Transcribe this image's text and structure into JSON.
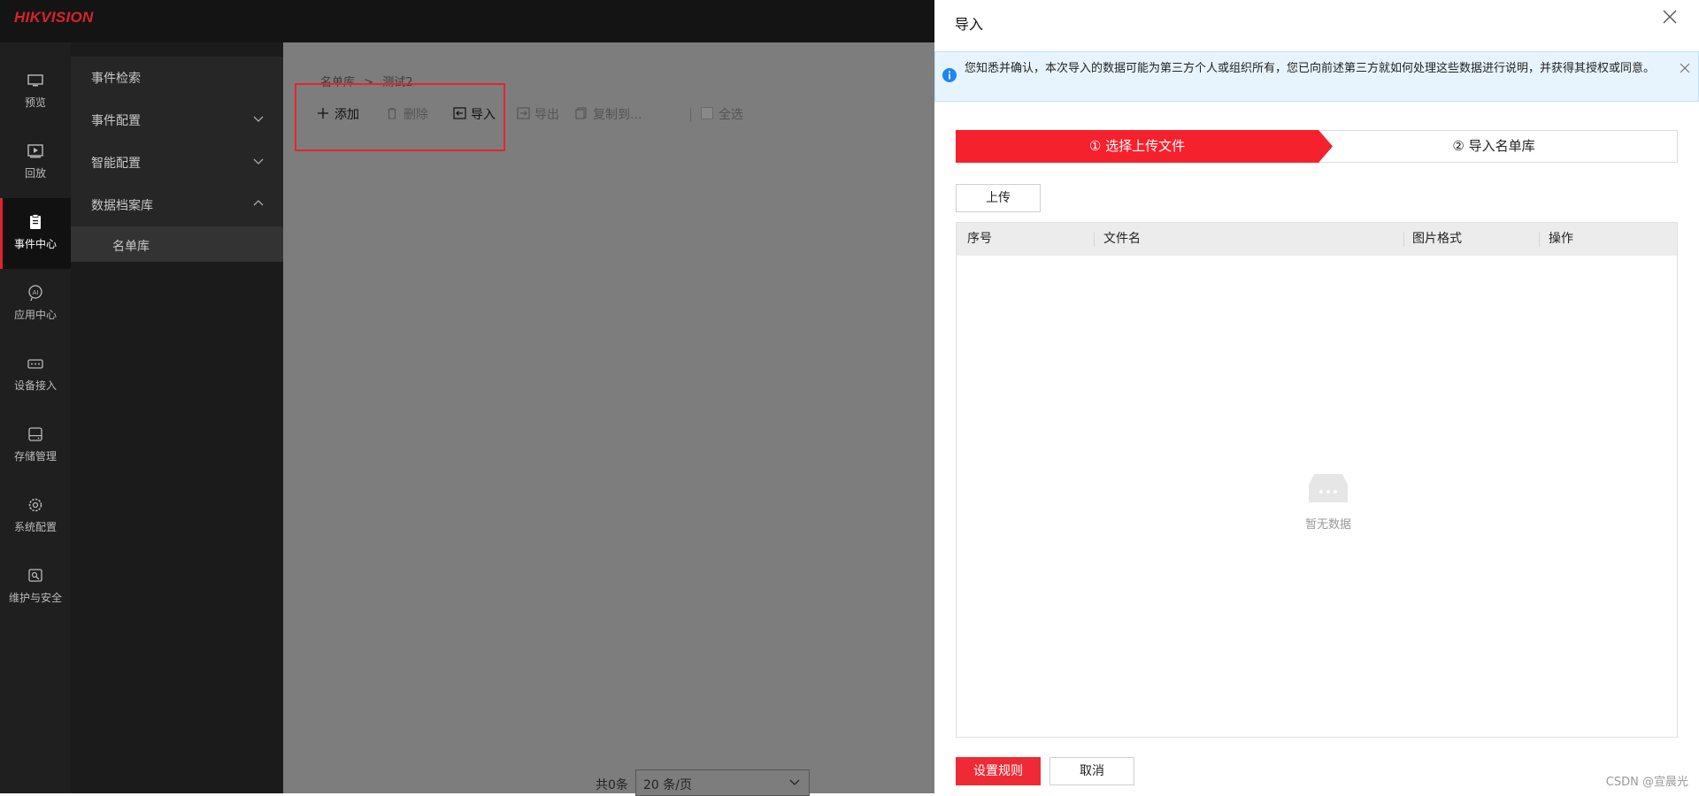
{
  "app": {
    "logo": "HIKVISION"
  },
  "nav": {
    "items": [
      {
        "label": "预览",
        "icon": "monitor-icon"
      },
      {
        "label": "回放",
        "icon": "playback-icon"
      },
      {
        "label": "事件中心",
        "icon": "clipboard-icon"
      },
      {
        "label": "应用中心",
        "icon": "ai-icon"
      },
      {
        "label": "设备接入",
        "icon": "device-icon"
      },
      {
        "label": "存储管理",
        "icon": "storage-icon"
      },
      {
        "label": "系统配置",
        "icon": "gear-icon"
      },
      {
        "label": "维护与安全",
        "icon": "maintenance-icon"
      }
    ],
    "active_index": 2
  },
  "subnav": {
    "items": [
      {
        "label": "事件检索"
      },
      {
        "label": "事件配置"
      },
      {
        "label": "智能配置"
      },
      {
        "label": "数据档案库"
      },
      {
        "label": "名单库"
      }
    ]
  },
  "content": {
    "breadcrumb": {
      "root": "名单库",
      "separator": ">",
      "current": "测试2"
    },
    "toolbar": {
      "add": "添加",
      "delete": "删除",
      "import": "导入",
      "export": "导出",
      "copy_to": "复制到...",
      "select_all": "全选"
    },
    "pager": {
      "total": "共0条",
      "page_size": "20 条/页"
    }
  },
  "dialog": {
    "title": "导入",
    "notice": "您知悉并确认，本次导入的数据可能为第三方个人或组织所有，您已向前述第三方就如何处理这些数据进行说明，并获得其授权或同意。",
    "steps": [
      {
        "label": "① 选择上传文件",
        "state": "active"
      },
      {
        "label": "② 导入名单库",
        "state": "pending"
      }
    ],
    "upload_label": "上传",
    "columns": [
      "序号",
      "文件名",
      "图片格式",
      "操作"
    ],
    "rows": [],
    "empty_text": "暂无数据",
    "primary_button": "设置规则",
    "cancel_button": "取消"
  },
  "watermark": "CSDN @宣晨光",
  "colors": {
    "accent": "#ee2b35",
    "topbar": "#141414",
    "sidebar": "#1f1f1f",
    "overlay": "#7d7d7d",
    "notice_bg": "#e8f4fd"
  }
}
